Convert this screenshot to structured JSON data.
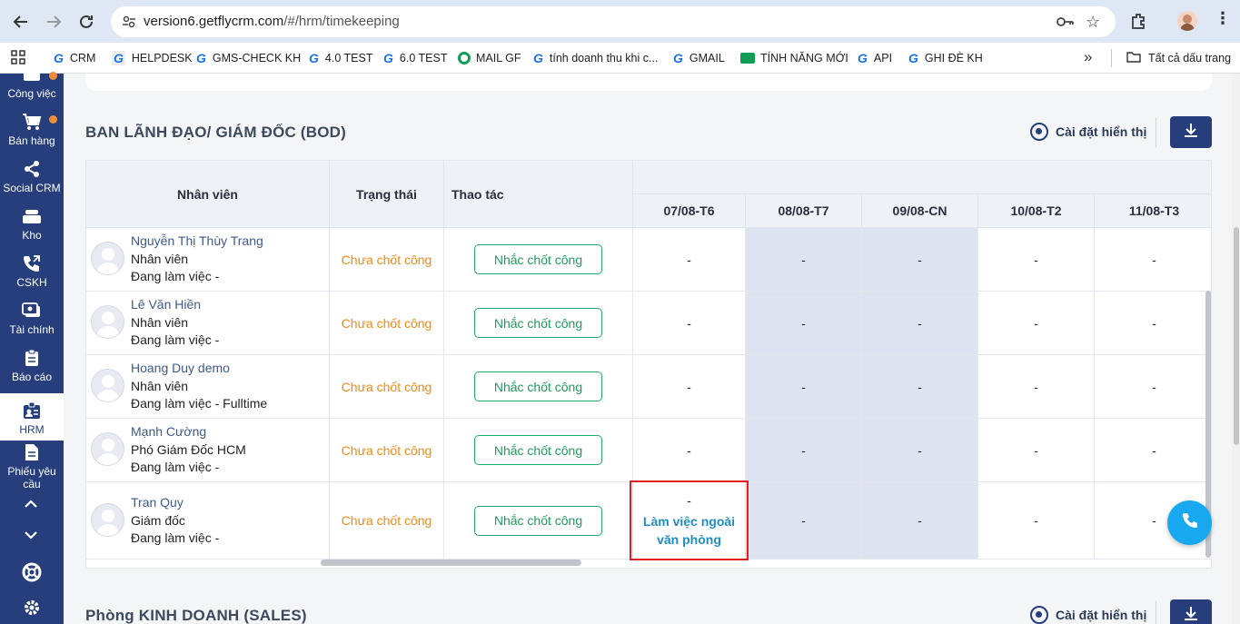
{
  "browser": {
    "url_host": "version6.getflycrm.com",
    "url_path": "/#/hrm/timekeeping",
    "bookmarks": [
      {
        "label": "CRM"
      },
      {
        "label": "HELPDESK"
      },
      {
        "label": "GMS-CHECK KH"
      },
      {
        "label": "4.0 TEST"
      },
      {
        "label": "6.0 TEST"
      },
      {
        "label": "MAIL GF"
      },
      {
        "label": "tính doanh thu khi c..."
      },
      {
        "label": "GMAIL"
      },
      {
        "label": "TÍNH NĂNG MỚI"
      },
      {
        "label": "API"
      },
      {
        "label": "GHI ĐÈ KH"
      }
    ],
    "all_bookmarks": "Tất cả dấu trang"
  },
  "sidebar": {
    "items": [
      {
        "label": "Công việc",
        "icon": "briefcase-icon"
      },
      {
        "label": "Bán hàng",
        "icon": "cart-icon"
      },
      {
        "label": "Social CRM",
        "icon": "share-icon"
      },
      {
        "label": "Kho",
        "icon": "warehouse-icon"
      },
      {
        "label": "CSKH",
        "icon": "phone-icon"
      },
      {
        "label": "Tài chính",
        "icon": "money-icon"
      },
      {
        "label": "Báo cáo",
        "icon": "report-icon"
      },
      {
        "label": "HRM",
        "icon": "id-badge-icon"
      },
      {
        "label": "Phiếu yêu cầu",
        "icon": "document-icon"
      }
    ]
  },
  "section1": {
    "title": "BAN LÃNH ĐẠO/ GIÁM ĐỐC (BOD)",
    "settings_label": "Cài đặt hiển thị"
  },
  "section2": {
    "title": "Phòng KINH DOANH (SALES)",
    "settings_label": "Cài đặt hiển thị"
  },
  "table": {
    "headers": {
      "employee": "Nhân viên",
      "status": "Trạng thái",
      "action": "Thao tác"
    },
    "days": [
      "07/08-T6",
      "08/08-T7",
      "09/08-CN",
      "10/08-T2",
      "11/08-T3"
    ],
    "rows": [
      {
        "name": "Nguyễn Thị Thùy Trang",
        "position": "Nhân viên",
        "work": "Đang làm việc -",
        "status": "Chưa chốt công",
        "action": "Nhắc chốt công",
        "days": [
          "-",
          "-",
          "-",
          "-",
          "-"
        ]
      },
      {
        "name": "Lê Văn Hiền",
        "position": "Nhân viên",
        "work": "Đang làm việc -",
        "status": "Chưa chốt công",
        "action": "Nhắc chốt công",
        "days": [
          "-",
          "-",
          "-",
          "-",
          "-"
        ]
      },
      {
        "name": "Hoang Duy demo",
        "position": "Nhân viên",
        "work": "Đang làm việc - Fulltime",
        "status": "Chưa chốt công",
        "action": "Nhắc chốt công",
        "days": [
          "-",
          "-",
          "-",
          "-",
          "-"
        ]
      },
      {
        "name": "Mạnh Cường",
        "position": "Phó Giám Đốc HCM",
        "work": "Đang làm việc -",
        "status": "Chưa chốt công",
        "action": "Nhắc chốt công",
        "days": [
          "-",
          "-",
          "-",
          "-",
          "-"
        ]
      },
      {
        "name": "Tran Quy",
        "position": "Giám đốc",
        "work": "Đang làm việc -",
        "status": "Chưa chốt công",
        "action": "Nhắc chốt công",
        "days": [
          "-",
          "-",
          "-",
          "-",
          "-"
        ],
        "note_line1": "Làm việc ngoài",
        "note_line2": "văn phòng"
      }
    ]
  }
}
